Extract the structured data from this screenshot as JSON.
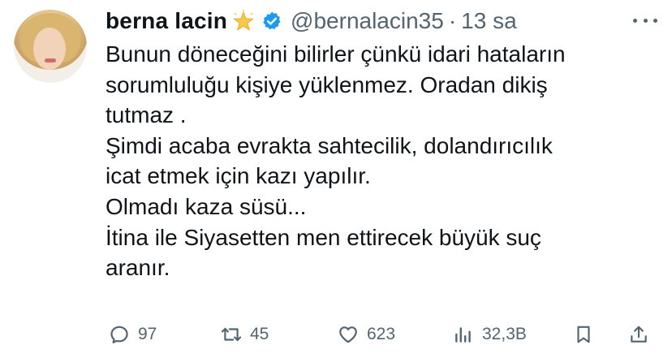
{
  "author": {
    "display_name": "berna lacin",
    "handle": "@bernalacin35",
    "separator": "·",
    "time": "13 sa",
    "badge_emoji_icon": "glowing-star-icon",
    "verified_icon": "verified-badge-icon",
    "verified_color": "#1d9bf0"
  },
  "tweet": {
    "text": "Bunun döneceğini bilirler çünkü idari hataların\nsorumluluğu kişiye yüklenmez. Oradan dikiş\ntutmaz .\nŞimdi acaba evrakta sahtecilik, dolandırıcılık\nicat etmek için kazı yapılır.\nOlmadı kaza süsü...\nİtina ile Siyasetten men ettirecek büyük suç\naranır."
  },
  "actions": {
    "replies": "97",
    "reposts": "45",
    "likes": "623",
    "views": "32,3B"
  },
  "colors": {
    "text": "#0f1419",
    "secondary": "#536471",
    "accent": "#1d9bf0"
  }
}
